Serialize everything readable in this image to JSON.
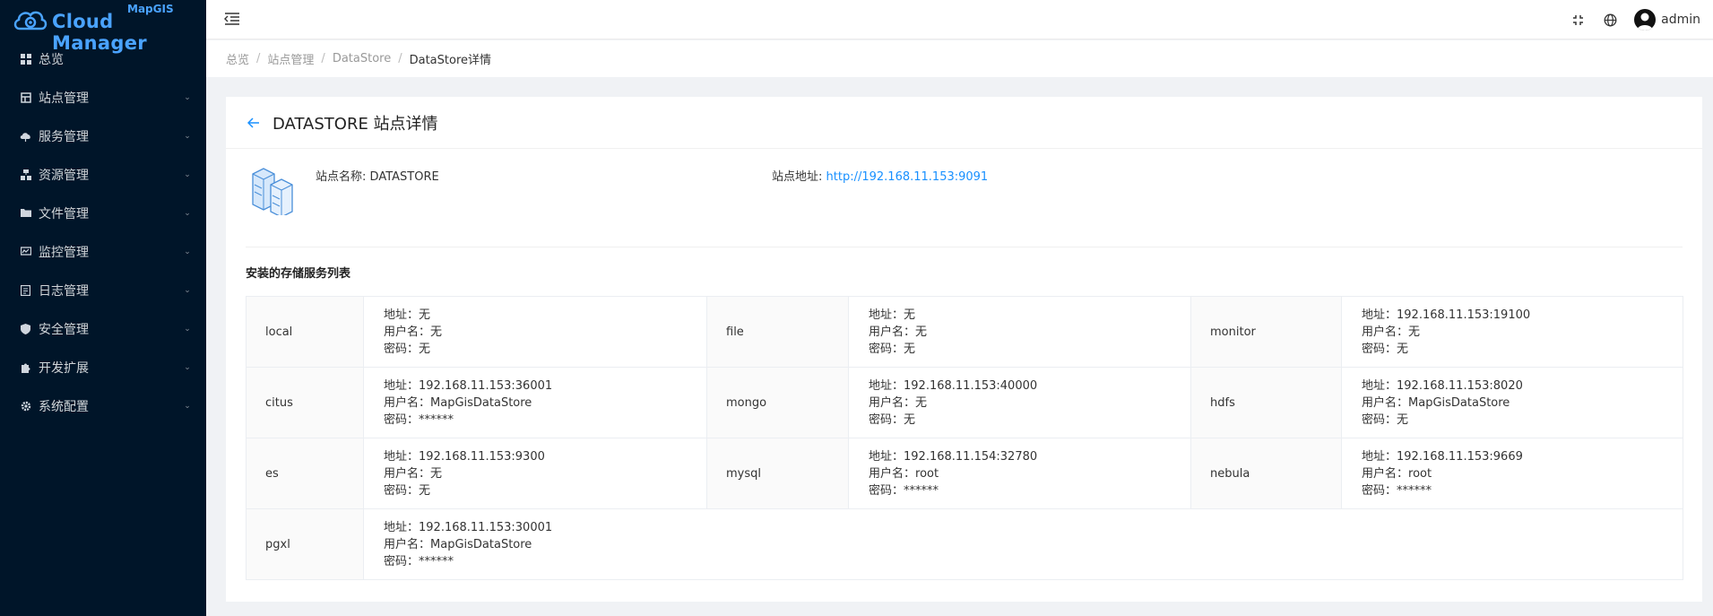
{
  "app": {
    "brand_top": "MapGIS",
    "brand_main": "Cloud Manager"
  },
  "sidebar": {
    "items": [
      {
        "label": "总览",
        "icon": "dashboard-icon",
        "has_children": false
      },
      {
        "label": "站点管理",
        "icon": "site-icon",
        "has_children": true
      },
      {
        "label": "服务管理",
        "icon": "cloud-service-icon",
        "has_children": true
      },
      {
        "label": "资源管理",
        "icon": "resource-icon",
        "has_children": true
      },
      {
        "label": "文件管理",
        "icon": "folder-icon",
        "has_children": true
      },
      {
        "label": "监控管理",
        "icon": "monitor-icon",
        "has_children": true
      },
      {
        "label": "日志管理",
        "icon": "log-icon",
        "has_children": true
      },
      {
        "label": "安全管理",
        "icon": "shield-icon",
        "has_children": true
      },
      {
        "label": "开发扩展",
        "icon": "puzzle-icon",
        "has_children": true
      },
      {
        "label": "系统配置",
        "icon": "gear-icon",
        "has_children": true
      }
    ]
  },
  "header": {
    "username": "admin",
    "icons": [
      "fullscreen-icon",
      "globe-icon",
      "avatar"
    ]
  },
  "breadcrumb": [
    "总览",
    "站点管理",
    "DataStore",
    "DataStore详情"
  ],
  "page": {
    "title": "DATASTORE 站点详情",
    "site_name_label": "站点名称:",
    "site_name": "DATASTORE",
    "site_addr_label": "站点地址:",
    "site_addr": "http://192.168.11.153:9091",
    "section_title": "安装的存储服务列表"
  },
  "labels": {
    "addr": "地址：",
    "user": "用户名：",
    "pwd": "密码："
  },
  "services": [
    {
      "name": "local",
      "addr": "无",
      "user": "无",
      "pwd": "无"
    },
    {
      "name": "file",
      "addr": "无",
      "user": "无",
      "pwd": "无"
    },
    {
      "name": "monitor",
      "addr": "192.168.11.153:19100",
      "user": "无",
      "pwd": "无"
    },
    {
      "name": "citus",
      "addr": "192.168.11.153:36001",
      "user": "MapGisDataStore",
      "pwd": "******"
    },
    {
      "name": "mongo",
      "addr": "192.168.11.153:40000",
      "user": "无",
      "pwd": "无"
    },
    {
      "name": "hdfs",
      "addr": "192.168.11.153:8020",
      "user": "MapGisDataStore",
      "pwd": "无"
    },
    {
      "name": "es",
      "addr": "192.168.11.153:9300",
      "user": "无",
      "pwd": "无"
    },
    {
      "name": "mysql",
      "addr": "192.168.11.154:32780",
      "user": "root",
      "pwd": "******"
    },
    {
      "name": "nebula",
      "addr": "192.168.11.153:9669",
      "user": "root",
      "pwd": "******"
    },
    {
      "name": "pgxl",
      "addr": "192.168.11.153:30001",
      "user": "MapGisDataStore",
      "pwd": "******"
    }
  ],
  "colors": {
    "sidebar_bg": "#001529",
    "accent": "#1890ff",
    "brand": "#4aa3ff"
  }
}
